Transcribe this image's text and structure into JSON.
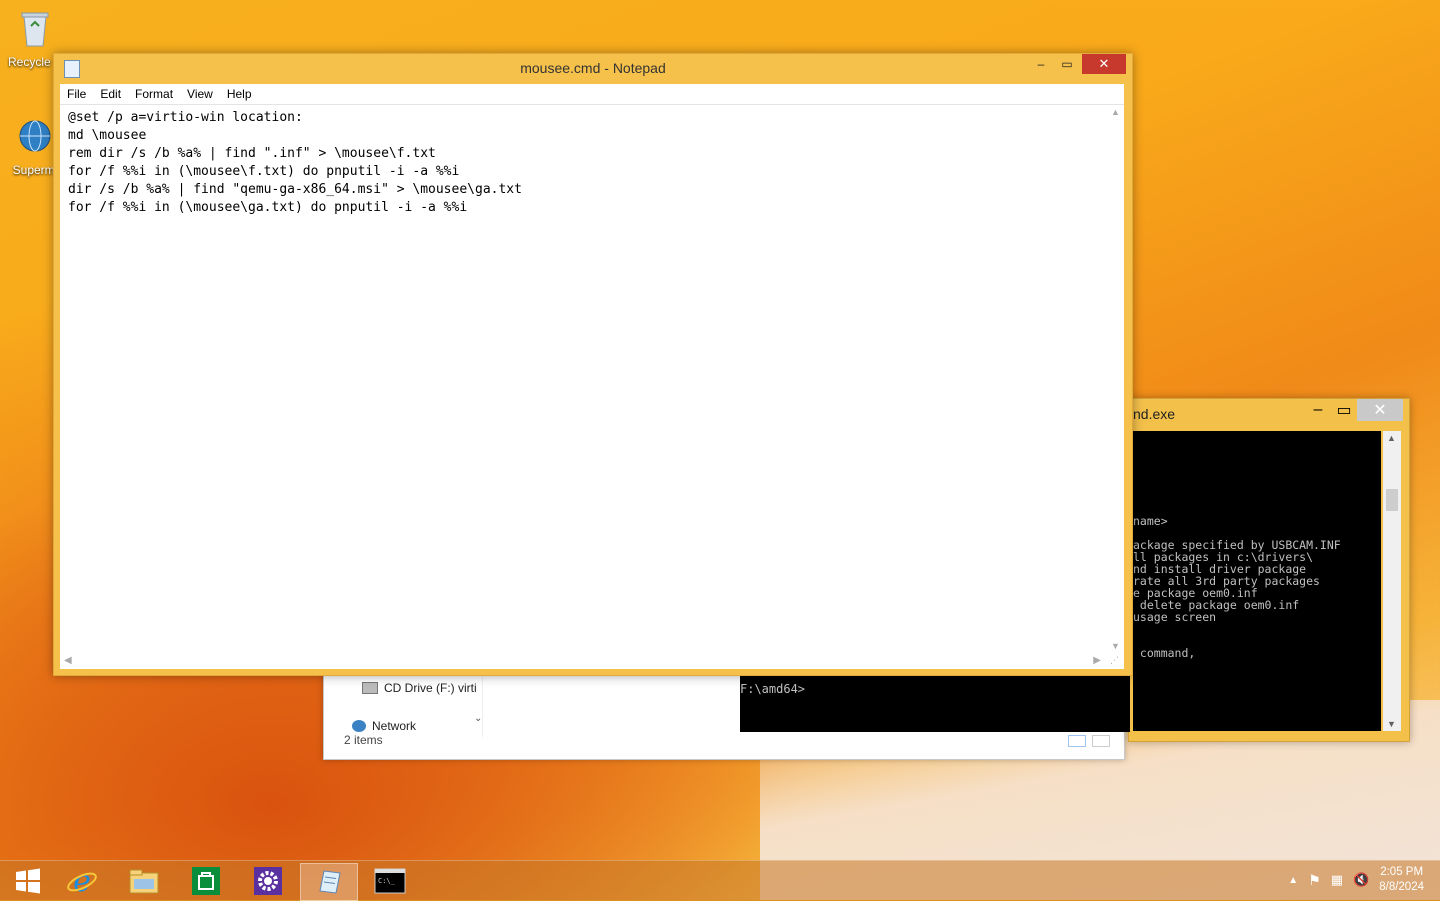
{
  "desktop": {
    "icons": [
      {
        "label": "Recycle B"
      },
      {
        "label": "Supermi"
      }
    ]
  },
  "explorer": {
    "nav_items": [
      "CD Drive (F:) virti",
      "Network"
    ],
    "status": "2 items"
  },
  "cmd": {
    "title": "nd.exe",
    "lines": [
      "name>",
      "",
      "ackage specified by USBCAM.INF",
      "ll packages in c:\\drivers\\",
      "nd install driver package",
      "rate all 3rd party packages",
      "e package oem0.inf",
      " delete package oem0.inf",
      "usage screen",
      "",
      "",
      " command,"
    ],
    "prompt": "F:\\amd64>"
  },
  "notepad": {
    "title": "mousee.cmd - Notepad",
    "menu": [
      "File",
      "Edit",
      "Format",
      "View",
      "Help"
    ],
    "content": "@set /p a=virtio-win location:\nmd \\mousee\nrem dir /s /b %a% | find \".inf\" > \\mousee\\f.txt\nfor /f %%i in (\\mousee\\f.txt) do pnputil -i -a %%i\ndir /s /b %a% | find \"qemu-ga-x86_64.msi\" > \\mousee\\ga.txt\nfor /f %%i in (\\mousee\\ga.txt) do pnputil -i -a %%i"
  },
  "taskbar": {
    "items": [
      "start",
      "internet-explorer",
      "file-explorer",
      "store",
      "control-panel",
      "notepad",
      "command-prompt"
    ],
    "active": "notepad",
    "clock_time": "2:05 PM",
    "clock_date": "8/8/2024"
  }
}
